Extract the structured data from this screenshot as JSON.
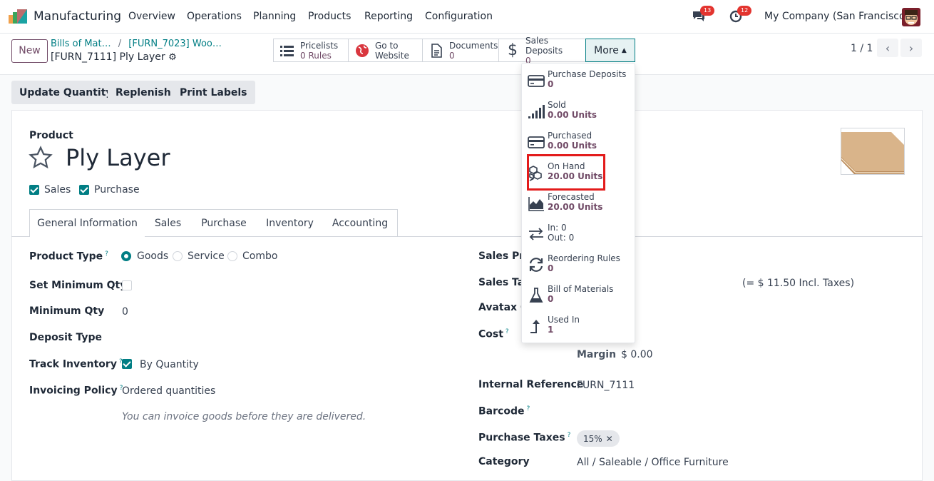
{
  "app": {
    "name": "Manufacturing"
  },
  "menu": [
    "Overview",
    "Operations",
    "Planning",
    "Products",
    "Reporting",
    "Configuration"
  ],
  "systray": {
    "messages_count": "13",
    "activities_count": "12",
    "company": "My Company (San Francisco)"
  },
  "control": {
    "new_label": "New",
    "breadcrumb_1": "Bills of Mat…",
    "breadcrumb_2": "[FURN_7023] Woo…",
    "record_title": "[FURN_7111] Ply Layer",
    "pager": "1 / 1",
    "more_label": "More"
  },
  "smart_buttons": [
    {
      "label": "Pricelists",
      "value": "0 Rules",
      "icon": "list-icon"
    },
    {
      "label": "Go to",
      "value": "Website",
      "icon": "globe-icon"
    },
    {
      "label": "Documents",
      "value": "0",
      "icon": "document-icon"
    },
    {
      "label": "Sales Deposits",
      "value": "0",
      "icon": "dollar-icon"
    }
  ],
  "more_menu": [
    {
      "label": "Purchase Deposits",
      "value": "0",
      "icon": "credit-card-icon"
    },
    {
      "label": "Sold",
      "value": "0.00 Units",
      "icon": "signal-icon"
    },
    {
      "label": "Purchased",
      "value": "0.00 Units",
      "icon": "credit-card-icon"
    },
    {
      "label": "On Hand",
      "value": "20.00 Units",
      "icon": "cubes-icon"
    },
    {
      "label": "Forecasted",
      "value": "20.00 Units",
      "icon": "area-chart-icon"
    },
    {
      "label": "In: 0",
      "value": "Out: 0",
      "icon": "exchange-icon"
    },
    {
      "label": "Reordering Rules",
      "value": "0",
      "icon": "refresh-icon"
    },
    {
      "label": "Bill of Materials",
      "value": "0",
      "icon": "flask-icon"
    },
    {
      "label": "Used In",
      "value": "1",
      "icon": "level-up-icon"
    }
  ],
  "actions": [
    "Update Quantity",
    "Replenish",
    "Print Labels"
  ],
  "product": {
    "section_label": "Product",
    "name": "Ply Layer",
    "sales_label": "Sales",
    "purchase_label": "Purchase"
  },
  "tabs": [
    "General Information",
    "Sales",
    "Purchase",
    "Inventory",
    "Accounting"
  ],
  "general": {
    "product_type_label": "Product Type",
    "type_options": [
      "Goods",
      "Service",
      "Combo"
    ],
    "set_min_qty_label": "Set Minimum Qty",
    "min_qty_label": "Minimum Qty",
    "min_qty_value": "0",
    "deposit_type_label": "Deposit Type",
    "track_inventory_label": "Track Inventory",
    "track_inventory_value": "By Quantity",
    "invoicing_policy_label": "Invoicing Policy",
    "invoicing_policy_value": "Ordered quantities",
    "invoicing_hint": "You can invoice goods before they are delivered.",
    "sales_price_label": "Sales Pric",
    "sales_taxes_label": "Sales Tax",
    "sales_incl": "(= $ 11.50 Incl. Taxes)",
    "avatax_label": "Avatax Ca",
    "cost_label": "Cost",
    "margin_label": "Margin",
    "margin_value": "$ 0.00",
    "internal_ref_label": "Internal Reference",
    "internal_ref_value": "FURN_7111",
    "barcode_label": "Barcode",
    "purchase_taxes_label": "Purchase Taxes",
    "purchase_tax_tag": "15%",
    "category_label": "Category",
    "category_value": "All / Saleable / Office Furniture"
  },
  "colors": {
    "brand": "#714b67",
    "accent": "#017e84",
    "highlight": "#e31b1b"
  }
}
